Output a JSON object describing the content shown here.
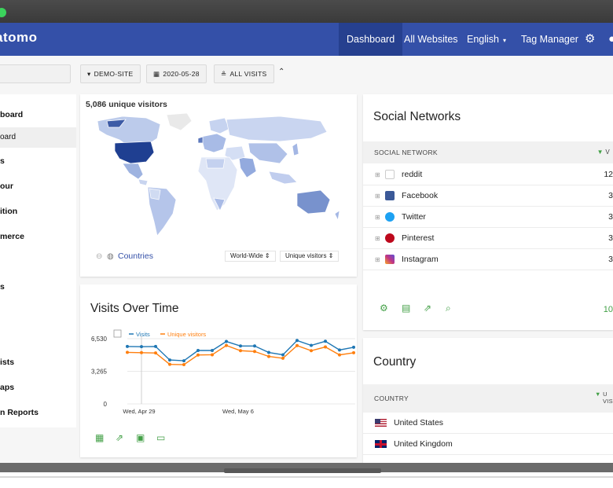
{
  "app": {
    "logo": "atomo"
  },
  "nav": {
    "items": [
      {
        "label": "Dashboard"
      },
      {
        "label": "All Websites"
      },
      {
        "label": "English",
        "caret": "▾"
      },
      {
        "label": "Tag Manager"
      }
    ],
    "settings_icon": "gear-icon",
    "extra_icon": "more-icon"
  },
  "controls": {
    "site": "DEMO-SITE",
    "date": "2020-05-28",
    "segment": "ALL VISITS",
    "collapse_glyph": "⌃"
  },
  "sidebar": {
    "items": [
      {
        "label": "board",
        "type": "section"
      },
      {
        "label": "oard",
        "type": "sub"
      },
      {
        "label": "s",
        "type": "section"
      },
      {
        "label": "our",
        "type": "section"
      },
      {
        "label": "ition",
        "type": "section"
      },
      {
        "label": "merce",
        "type": "section"
      },
      {
        "label": "s",
        "type": "section"
      },
      {
        "label": "ists",
        "type": "section"
      },
      {
        "label": "aps",
        "type": "section"
      },
      {
        "label": "n Reports",
        "type": "section"
      }
    ]
  },
  "map_widget": {
    "title": "5,086 unique visitors",
    "link": "Countries",
    "region": "World-Wide",
    "metric": "Unique visitors"
  },
  "visits_widget": {
    "title": "Visits Over Time",
    "legend": [
      "Visits",
      "Unique visitors"
    ],
    "footer_icons": [
      "calendar-icon",
      "export-icon",
      "image-icon",
      "annotation-icon"
    ]
  },
  "chart_data": {
    "type": "line",
    "x": [
      "Apr 28",
      "Apr 29",
      "Apr 30",
      "May 1",
      "May 2",
      "May 3",
      "May 4",
      "May 5",
      "May 6",
      "May 7",
      "May 8",
      "May 9",
      "May 10",
      "May 11",
      "May 12",
      "May 13",
      "May 14"
    ],
    "xticks": [
      "Wed, Apr 29",
      "Wed, May 6"
    ],
    "yticks": [
      "6,530",
      "3,265",
      "0"
    ],
    "ylim": [
      0,
      6530
    ],
    "series": [
      {
        "name": "Visits",
        "color": "#1f77b4",
        "values": [
          5750,
          5730,
          5750,
          4400,
          4320,
          5350,
          5350,
          6250,
          5800,
          5800,
          5150,
          4920,
          6350,
          5860,
          6270,
          5400,
          5670
        ]
      },
      {
        "name": "Unique visitors",
        "color": "#ff7f0e",
        "values": [
          5160,
          5130,
          5100,
          3960,
          3930,
          4900,
          4920,
          5850,
          5330,
          5250,
          4750,
          4570,
          5840,
          5330,
          5700,
          4910,
          5120
        ]
      }
    ]
  },
  "social": {
    "title": "Social Networks",
    "col_header": "SOCIAL NETWORK",
    "col_value_header": "V",
    "sort_glyph": "▼",
    "rows": [
      {
        "label": "reddit",
        "value": "12",
        "icon": "reddit-icon",
        "color": "#ff4500"
      },
      {
        "label": "Facebook",
        "value": "3",
        "icon": "facebook-icon",
        "color": "#3b5998"
      },
      {
        "label": "Twitter",
        "value": "3",
        "icon": "twitter-icon",
        "color": "#1da1f2"
      },
      {
        "label": "Pinterest",
        "value": "3",
        "icon": "pinterest-icon",
        "color": "#bd081c"
      },
      {
        "label": "Instagram",
        "value": "3",
        "icon": "instagram-icon",
        "color": "#c13584"
      }
    ],
    "footer_icons": [
      "gear-icon",
      "table-icon",
      "export-icon",
      "search-icon"
    ],
    "footer_value": "10"
  },
  "country": {
    "title": "Country",
    "col_header": "COUNTRY",
    "col_value_header_1": "U",
    "col_value_header_2": "VIS",
    "sort_glyph": "▼",
    "rows": [
      {
        "label": "United States",
        "icon": "us-flag-icon"
      },
      {
        "label": "United Kingdom",
        "icon": "uk-flag-icon"
      }
    ]
  }
}
